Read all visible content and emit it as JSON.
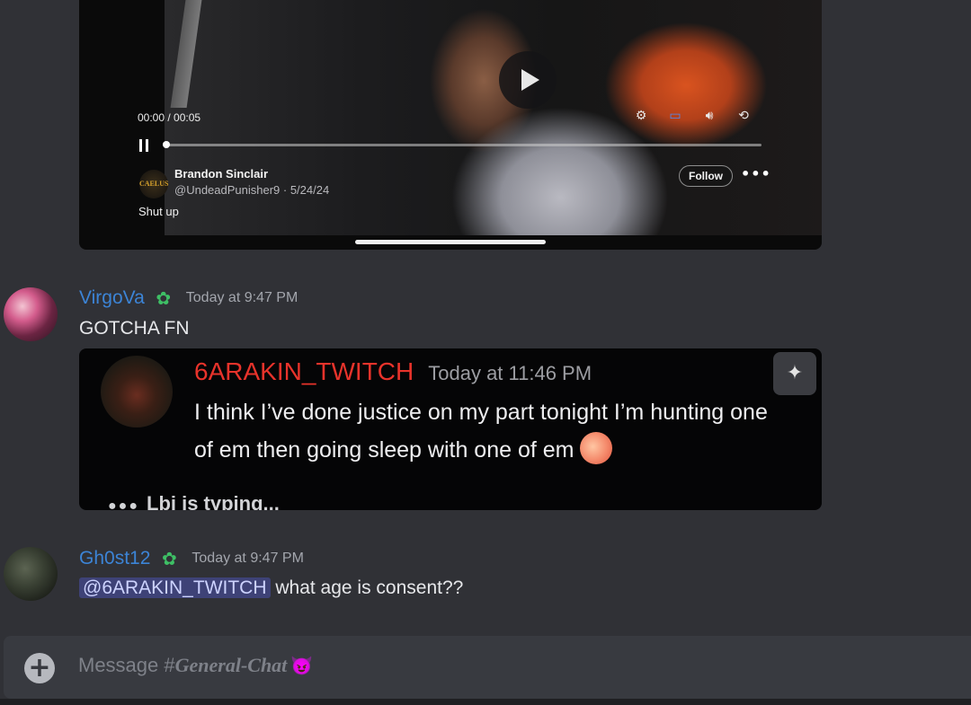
{
  "video": {
    "time": "00:00 / 00:05",
    "author_name": "Brandon Sinclair",
    "author_handle": "@UndeadPunisher9 · 5/24/24",
    "caption": "Shut up",
    "follow_label": "Follow",
    "progress": 0.0,
    "avatar_text": "CAELUS",
    "icons": [
      "settings-icon",
      "airplay-icon",
      "volume-icon",
      "rotate-icon",
      "pause-icon",
      "play-icon",
      "more-icon"
    ]
  },
  "messages": [
    {
      "username": "VirgoVa",
      "timestamp": "Today at 9:47 PM",
      "text": "GOTCHA FN",
      "user_color": "#3c84d6"
    },
    {
      "username": "Gh0st12",
      "timestamp": "Today at 9:47 PM",
      "mention": "@6ARAKIN_TWITCH",
      "text": " what age is consent??",
      "user_color": "#3c84d6"
    }
  ],
  "attachment": {
    "username": "6ARAKIN_TWITCH",
    "timestamp": "Today at 11:46 PM",
    "text": "I think I’ve done justice on my part tonight I’m hunting one of em then going sleep with one of em",
    "emoji": "peach",
    "typing": "Lbi is typing...",
    "username_color": "#e8332b"
  },
  "composer": {
    "placeholder_prefix": "Message #",
    "channel_name": "General-Chat",
    "channel_emoji": "devil-icon"
  }
}
